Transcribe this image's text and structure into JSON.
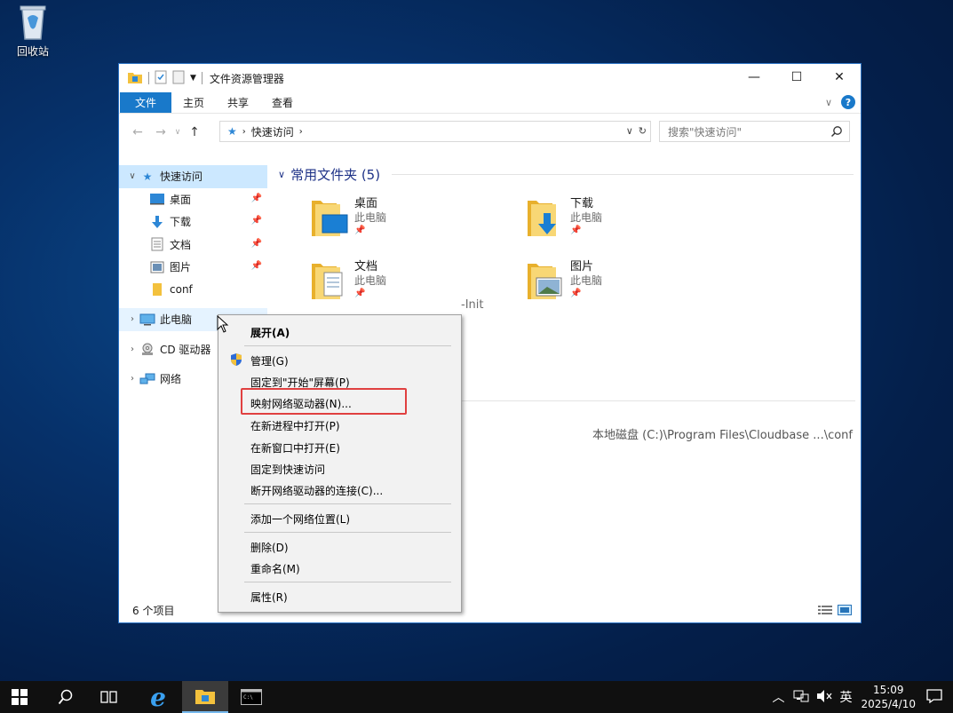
{
  "desktop": {
    "recycle_bin_label": "回收站"
  },
  "window": {
    "title": "文件资源管理器",
    "controls": {
      "minimize": "—",
      "maximize": "☐",
      "close": "✕"
    }
  },
  "ribbon": {
    "tabs": [
      {
        "label": "文件"
      },
      {
        "label": "主页"
      },
      {
        "label": "共享"
      },
      {
        "label": "查看"
      }
    ]
  },
  "address": {
    "path": "快速访问",
    "search_placeholder": "搜索\"快速访问\""
  },
  "navpane": {
    "quick_access": "快速访问",
    "items": [
      {
        "label": "桌面",
        "icon": "desktop-icon",
        "pinned": true
      },
      {
        "label": "下载",
        "icon": "download-icon",
        "pinned": true
      },
      {
        "label": "文档",
        "icon": "document-icon",
        "pinned": true
      },
      {
        "label": "图片",
        "icon": "pictures-icon",
        "pinned": true
      },
      {
        "label": "conf",
        "icon": "folder-icon",
        "pinned": false
      }
    ],
    "this_pc": "此电脑",
    "cd_drive": "CD 驱动器",
    "network": "网络"
  },
  "content": {
    "frequent_header": "常用文件夹 (5)",
    "folders": [
      {
        "name": "桌面",
        "location": "此电脑"
      },
      {
        "name": "下载",
        "location": "此电脑"
      },
      {
        "name": "文档",
        "location": "此电脑"
      },
      {
        "name": "图片",
        "location": "此电脑"
      }
    ],
    "partial_label": "-Init",
    "recent_path": "本地磁盘 (C:)\\Program Files\\Cloudbase ...\\conf"
  },
  "statusbar": {
    "count": "6 个项目"
  },
  "context_menu": {
    "items": [
      {
        "label": "展开(A)"
      },
      {
        "label": "管理(G)"
      },
      {
        "label": "固定到\"开始\"屏幕(P)"
      },
      {
        "label": "映射网络驱动器(N)..."
      },
      {
        "label": "在新进程中打开(P)"
      },
      {
        "label": "在新窗口中打开(E)"
      },
      {
        "label": "固定到快速访问"
      },
      {
        "label": "断开网络驱动器的连接(C)..."
      },
      {
        "label": "添加一个网络位置(L)"
      },
      {
        "label": "删除(D)"
      },
      {
        "label": "重命名(M)"
      },
      {
        "label": "属性(R)"
      }
    ]
  },
  "taskbar": {
    "time": "15:09",
    "date": "2025/4/10",
    "language": "英"
  },
  "colors": {
    "accent": "#1979ca",
    "selection": "#cce8ff",
    "highlight_box": "#e04040",
    "taskbar": "#101010"
  }
}
